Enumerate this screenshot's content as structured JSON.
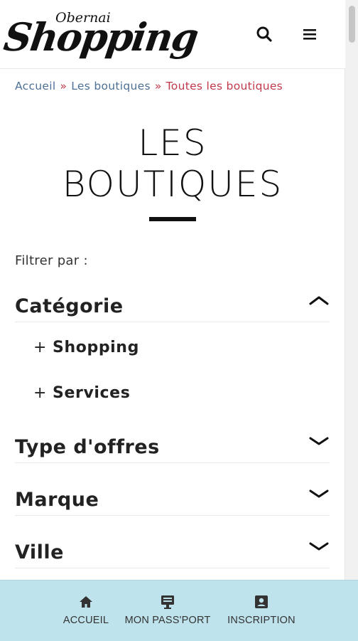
{
  "header": {
    "logo_small": "Obernai",
    "logo_big": "Shopping"
  },
  "breadcrumb": {
    "items": [
      "Accueil",
      "Les boutiques"
    ],
    "separator": "»",
    "current": "Toutes les boutiques"
  },
  "page": {
    "title_line1": "LES",
    "title_line2": "BOUTIQUES",
    "filter_label": "Filtrer par :"
  },
  "filters": [
    {
      "label": "Catégorie",
      "state": "expanded",
      "options": [
        "Shopping",
        "Services"
      ]
    },
    {
      "label": "Type d'offres",
      "state": "collapsed"
    },
    {
      "label": "Marque",
      "state": "collapsed"
    },
    {
      "label": "Ville",
      "state": "collapsed"
    }
  ],
  "bottom_nav": [
    {
      "label": "ACCUEIL",
      "icon": "home-icon"
    },
    {
      "label": "MON PASS'PORT",
      "icon": "pass-card-icon"
    },
    {
      "label": "INSCRIPTION",
      "icon": "contact-card-icon"
    }
  ],
  "colors": {
    "link": "#4c6f96",
    "current": "#c0394b",
    "bottom_bar": "#bfe3ec"
  }
}
